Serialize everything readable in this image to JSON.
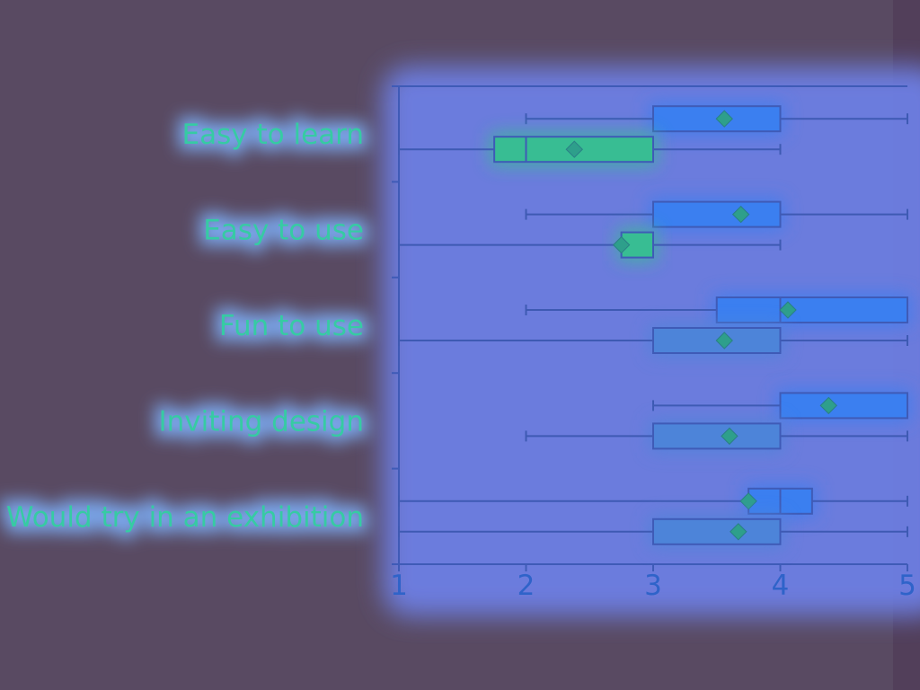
{
  "colors": {
    "background": "#594a62",
    "plot_glow": "#6d7fe4",
    "axis": "#3f5bb7",
    "whisker": "#3e5ab3",
    "box_blue": "#3b7ff0",
    "box_green": "#38bd93",
    "box_muted": "#4d84d9",
    "marker": "#2e9f8b",
    "label_green": "#36cba3",
    "tick_blue": "#2f63c9"
  },
  "chart_data": {
    "type": "boxplot",
    "orientation": "horizontal",
    "title": "",
    "xlabel": "",
    "ylabel": "",
    "xlim": [
      1,
      5
    ],
    "xticks": [
      1,
      2,
      3,
      4,
      5
    ],
    "grid": false,
    "legend": "none",
    "categories": [
      {
        "label": "Easy to learn",
        "boxes": [
          {
            "whisker_low": 2,
            "q1": 3,
            "median": 3,
            "q3": 4,
            "whisker_high": 5,
            "mean": 3.56,
            "color": "box_blue"
          },
          {
            "whisker_low": 1,
            "q1": 1.75,
            "median": 2,
            "q3": 3,
            "whisker_high": 4,
            "mean": 2.38,
            "color": "box_green"
          }
        ]
      },
      {
        "label": "Easy to use",
        "boxes": [
          {
            "whisker_low": 2,
            "q1": 3,
            "median": 3,
            "q3": 4,
            "whisker_high": 5,
            "mean": 3.69,
            "color": "box_blue"
          },
          {
            "whisker_low": 1,
            "q1": 2.75,
            "median": 3,
            "q3": 3,
            "whisker_high": 4,
            "mean": 2.75,
            "color": "box_green"
          }
        ]
      },
      {
        "label": "Fun to use",
        "boxes": [
          {
            "whisker_low": 2,
            "q1": 3.5,
            "median": 4,
            "q3": 5,
            "whisker_high": 5,
            "mean": 4.06,
            "color": "box_blue"
          },
          {
            "whisker_low": 1,
            "q1": 3,
            "median": 3,
            "q3": 4,
            "whisker_high": 5,
            "mean": 3.56,
            "color": "box_muted"
          }
        ]
      },
      {
        "label": "Inviting design",
        "boxes": [
          {
            "whisker_low": 3,
            "q1": 4,
            "median": 4,
            "q3": 5,
            "whisker_high": 5,
            "mean": 4.38,
            "color": "box_blue"
          },
          {
            "whisker_low": 2,
            "q1": 3,
            "median": 3,
            "q3": 4,
            "whisker_high": 5,
            "mean": 3.6,
            "color": "box_muted"
          }
        ]
      },
      {
        "label": "Would try in an exhibition",
        "boxes": [
          {
            "whisker_low": 1,
            "q1": 3.75,
            "median": 4,
            "q3": 4.25,
            "whisker_high": 5,
            "mean": 3.75,
            "color": "box_blue"
          },
          {
            "whisker_low": 1,
            "q1": 3,
            "median": 3,
            "q3": 4,
            "whisker_high": 5,
            "mean": 3.67,
            "color": "box_muted"
          }
        ]
      }
    ]
  }
}
